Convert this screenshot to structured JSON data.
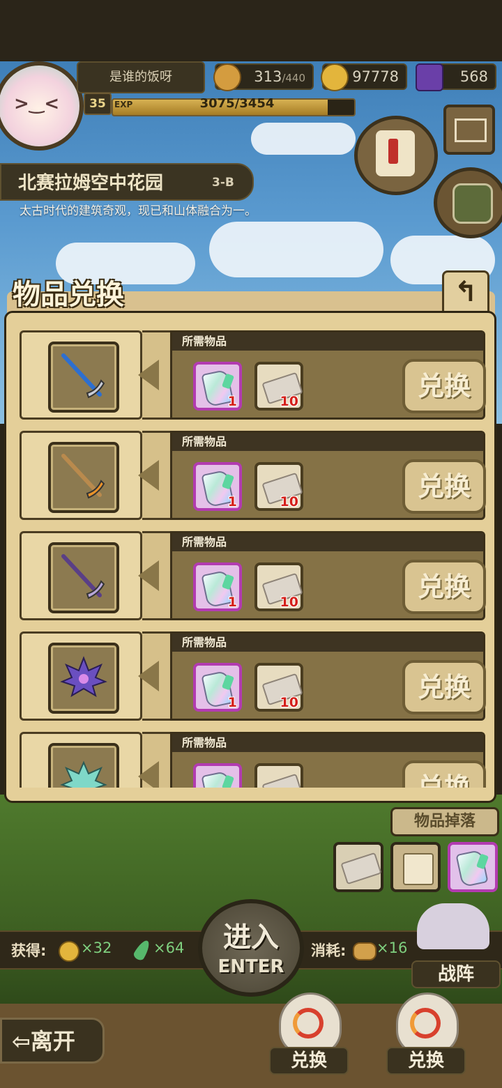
{
  "player": {
    "name": "是谁的饭呀",
    "level": "35",
    "exp_label": "EXP",
    "exp_text": "3075/3454",
    "exp_fraction": 0.89
  },
  "resources": {
    "stamina": "313",
    "stamina_max": "/440",
    "gold": "97778",
    "gems": "568"
  },
  "stage": {
    "title": "北赛拉姆空中花园",
    "code": "3-B",
    "description": "太古时代的建筑奇观，现已和山体融合为一。"
  },
  "exchange_panel": {
    "title": "物品兑换",
    "back_icon": "back-arrow-icon",
    "rows": [
      {
        "item": "blue-pickaxe",
        "required_label": "所需物品",
        "req1_count": "1",
        "req2_count": "10",
        "button": "兑换"
      },
      {
        "item": "wooden-pickaxe",
        "required_label": "所需物品",
        "req1_count": "1",
        "req2_count": "10",
        "button": "兑换"
      },
      {
        "item": "purple-pickaxe",
        "required_label": "所需物品",
        "req1_count": "1",
        "req2_count": "10",
        "button": "兑换"
      },
      {
        "item": "crystal-crown",
        "required_label": "所需物品",
        "req1_count": "1",
        "req2_count": "10",
        "button": "兑换"
      },
      {
        "item": "green-crystal-crown",
        "required_label": "所需物品",
        "req1_count": "",
        "req2_count": "",
        "button": "兑换"
      }
    ]
  },
  "drops": {
    "label": "物品掉落"
  },
  "rewards": {
    "gain_label": "获得:",
    "gold_gain": "×32",
    "feather_gain": "×64",
    "cost_label": "消耗:",
    "stamina_cost": "×16"
  },
  "actions": {
    "enter_cn": "进入",
    "enter_en": "ENTER",
    "formation": "战阵",
    "leave": "离开",
    "exchange1": "兑换",
    "exchange2": "兑换"
  },
  "colors": {
    "panel": "#e4cf99",
    "crystal_border": "#b23bb0",
    "count_red": "#d4201a"
  }
}
